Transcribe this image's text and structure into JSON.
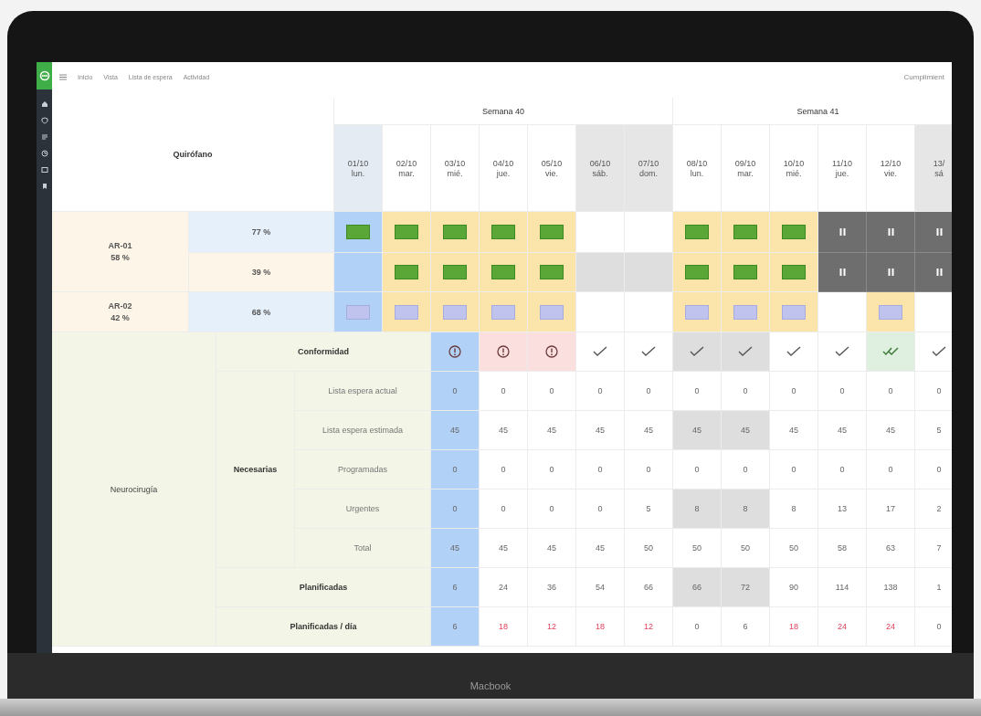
{
  "breadcrumb": [
    "Inicio",
    "Vista",
    "Lista de espera",
    "Actividad"
  ],
  "header_right": "Cumplimient",
  "table": {
    "corner": "Quirófano",
    "weeks": [
      {
        "label": "Semana 40",
        "days": [
          {
            "date": "01/10",
            "weekday": "lun.",
            "kind": "today"
          },
          {
            "date": "02/10",
            "weekday": "mar.",
            "kind": "workday"
          },
          {
            "date": "03/10",
            "weekday": "mié.",
            "kind": "workday"
          },
          {
            "date": "04/10",
            "weekday": "jue.",
            "kind": "workday"
          },
          {
            "date": "05/10",
            "weekday": "vie.",
            "kind": "workday"
          },
          {
            "date": "06/10",
            "weekday": "sáb.",
            "kind": "weekend"
          },
          {
            "date": "07/10",
            "weekday": "dom.",
            "kind": "weekend"
          }
        ]
      },
      {
        "label": "Semana 41",
        "days": [
          {
            "date": "08/10",
            "weekday": "lun.",
            "kind": "workday"
          },
          {
            "date": "09/10",
            "weekday": "mar.",
            "kind": "workday"
          },
          {
            "date": "10/10",
            "weekday": "mié.",
            "kind": "workday"
          },
          {
            "date": "11/10",
            "weekday": "jue.",
            "kind": "workday"
          },
          {
            "date": "12/10",
            "weekday": "vie.",
            "kind": "workday"
          },
          {
            "date": "13/",
            "weekday": "sá",
            "kind": "weekend"
          }
        ]
      }
    ],
    "rooms": [
      {
        "name": "AR-01",
        "percent": "58 %",
        "lines": [
          {
            "percent": "77 %",
            "highlighted": true,
            "cells": [
              {
                "kind": "session",
                "scheduled": false,
                "blocked": false
              },
              {
                "kind": "session",
                "scheduled": true,
                "blocked": false
              },
              {
                "kind": "session",
                "scheduled": true,
                "blocked": false
              },
              {
                "kind": "session",
                "scheduled": true,
                "blocked": false
              },
              {
                "kind": "session",
                "scheduled": true,
                "blocked": false
              },
              {
                "kind": "empty",
                "scheduled": false,
                "blocked": false
              },
              {
                "kind": "empty",
                "scheduled": false,
                "blocked": false
              },
              {
                "kind": "session",
                "scheduled": true,
                "blocked": false
              },
              {
                "kind": "session",
                "scheduled": true,
                "blocked": false
              },
              {
                "kind": "session",
                "scheduled": true,
                "blocked": false
              },
              {
                "kind": "closed"
              },
              {
                "kind": "closed"
              },
              {
                "kind": "closed"
              }
            ]
          },
          {
            "percent": "39 %",
            "highlighted": false,
            "cells": [
              {
                "kind": "empty",
                "scheduled": false,
                "blocked": false
              },
              {
                "kind": "session",
                "scheduled": true,
                "blocked": false
              },
              {
                "kind": "session",
                "scheduled": true,
                "blocked": false
              },
              {
                "kind": "session",
                "scheduled": true,
                "blocked": false
              },
              {
                "kind": "session",
                "scheduled": true,
                "blocked": false
              },
              {
                "kind": "empty",
                "scheduled": false,
                "blocked": true
              },
              {
                "kind": "empty",
                "scheduled": false,
                "blocked": true
              },
              {
                "kind": "session",
                "scheduled": true,
                "blocked": false
              },
              {
                "kind": "session",
                "scheduled": true,
                "blocked": false
              },
              {
                "kind": "session",
                "scheduled": true,
                "blocked": false
              },
              {
                "kind": "closed"
              },
              {
                "kind": "closed"
              },
              {
                "kind": "closed"
              }
            ]
          }
        ]
      },
      {
        "name": "AR-02",
        "percent": "42 %",
        "lines": [
          {
            "percent": "68 %",
            "highlighted": true,
            "cells": [
              {
                "kind": "reserved",
                "scheduled": false,
                "blocked": false
              },
              {
                "kind": "reserved",
                "scheduled": true,
                "blocked": false
              },
              {
                "kind": "reserved",
                "scheduled": true,
                "blocked": false
              },
              {
                "kind": "reserved",
                "scheduled": true,
                "blocked": false
              },
              {
                "kind": "reserved",
                "scheduled": true,
                "blocked": false
              },
              {
                "kind": "empty",
                "scheduled": false,
                "blocked": false
              },
              {
                "kind": "empty",
                "scheduled": false,
                "blocked": false
              },
              {
                "kind": "reserved",
                "scheduled": true,
                "blocked": false
              },
              {
                "kind": "reserved",
                "scheduled": true,
                "blocked": false
              },
              {
                "kind": "reserved",
                "scheduled": true,
                "blocked": false
              },
              {
                "kind": "empty",
                "scheduled": false,
                "blocked": false
              },
              {
                "kind": "reserved",
                "scheduled": true,
                "blocked": false
              },
              {
                "kind": "empty",
                "scheduled": false,
                "blocked": false
              }
            ]
          }
        ]
      }
    ],
    "service": "Neurocirugía",
    "conformity": {
      "label": "Conformidad",
      "cells": [
        {
          "kind": "warning",
          "current": true,
          "flagged": false,
          "dimmed": false,
          "highlighted": false
        },
        {
          "kind": "warning",
          "current": false,
          "flagged": true,
          "dimmed": false,
          "highlighted": false
        },
        {
          "kind": "warning",
          "current": false,
          "flagged": true,
          "dimmed": false,
          "highlighted": false
        },
        {
          "kind": "ok",
          "current": false,
          "flagged": false,
          "dimmed": false,
          "highlighted": false
        },
        {
          "kind": "ok",
          "current": false,
          "flagged": false,
          "dimmed": false,
          "highlighted": false
        },
        {
          "kind": "ok",
          "current": false,
          "flagged": false,
          "dimmed": true,
          "highlighted": false
        },
        {
          "kind": "ok",
          "current": false,
          "flagged": false,
          "dimmed": true,
          "highlighted": false
        },
        {
          "kind": "ok",
          "current": false,
          "flagged": false,
          "dimmed": false,
          "highlighted": false
        },
        {
          "kind": "ok",
          "current": false,
          "flagged": false,
          "dimmed": false,
          "highlighted": false
        },
        {
          "kind": "double",
          "current": false,
          "flagged": false,
          "dimmed": false,
          "highlighted": true
        },
        {
          "kind": "ok",
          "current": false,
          "flagged": false,
          "dimmed": false,
          "highlighted": false
        }
      ]
    },
    "needed": {
      "label": "Necesarias",
      "rows": [
        {
          "label": "Lista espera actual",
          "cells": [
            {
              "value": "0",
              "current": true,
              "dimmed": false
            },
            {
              "value": "0",
              "current": false,
              "dimmed": false
            },
            {
              "value": "0",
              "current": false,
              "dimmed": false
            },
            {
              "value": "0",
              "current": false,
              "dimmed": false
            },
            {
              "value": "0",
              "current": false,
              "dimmed": false
            },
            {
              "value": "0",
              "current": false,
              "dimmed": false
            },
            {
              "value": "0",
              "current": false,
              "dimmed": false
            },
            {
              "value": "0",
              "current": false,
              "dimmed": false
            },
            {
              "value": "0",
              "current": false,
              "dimmed": false
            },
            {
              "value": "0",
              "current": false,
              "dimmed": false
            },
            {
              "value": "0",
              "current": false,
              "dimmed": false
            }
          ]
        },
        {
          "label": "Lista espera estimada",
          "cells": [
            {
              "value": "45",
              "current": true,
              "dimmed": false
            },
            {
              "value": "45",
              "current": false,
              "dimmed": false
            },
            {
              "value": "45",
              "current": false,
              "dimmed": false
            },
            {
              "value": "45",
              "current": false,
              "dimmed": false
            },
            {
              "value": "45",
              "current": false,
              "dimmed": false
            },
            {
              "value": "45",
              "current": false,
              "dimmed": true
            },
            {
              "value": "45",
              "current": false,
              "dimmed": true
            },
            {
              "value": "45",
              "current": false,
              "dimmed": false
            },
            {
              "value": "45",
              "current": false,
              "dimmed": false
            },
            {
              "value": "45",
              "current": false,
              "dimmed": false
            },
            {
              "value": "5",
              "current": false,
              "dimmed": false
            }
          ]
        },
        {
          "label": "Programadas",
          "cells": [
            {
              "value": "0",
              "current": true,
              "dimmed": false
            },
            {
              "value": "0",
              "current": false,
              "dimmed": false
            },
            {
              "value": "0",
              "current": false,
              "dimmed": false
            },
            {
              "value": "0",
              "current": false,
              "dimmed": false
            },
            {
              "value": "0",
              "current": false,
              "dimmed": false
            },
            {
              "value": "0",
              "current": false,
              "dimmed": false
            },
            {
              "value": "0",
              "current": false,
              "dimmed": false
            },
            {
              "value": "0",
              "current": false,
              "dimmed": false
            },
            {
              "value": "0",
              "current": false,
              "dimmed": false
            },
            {
              "value": "0",
              "current": false,
              "dimmed": false
            },
            {
              "value": "0",
              "current": false,
              "dimmed": false
            }
          ]
        },
        {
          "label": "Urgentes",
          "cells": [
            {
              "value": "0",
              "current": true,
              "dimmed": false
            },
            {
              "value": "0",
              "current": false,
              "dimmed": false
            },
            {
              "value": "0",
              "current": false,
              "dimmed": false
            },
            {
              "value": "0",
              "current": false,
              "dimmed": false
            },
            {
              "value": "5",
              "current": false,
              "dimmed": false
            },
            {
              "value": "8",
              "current": false,
              "dimmed": true
            },
            {
              "value": "8",
              "current": false,
              "dimmed": true
            },
            {
              "value": "8",
              "current": false,
              "dimmed": false
            },
            {
              "value": "13",
              "current": false,
              "dimmed": false
            },
            {
              "value": "17",
              "current": false,
              "dimmed": false
            },
            {
              "value": "2",
              "current": false,
              "dimmed": false
            }
          ]
        },
        {
          "label": "Total",
          "cells": [
            {
              "value": "45",
              "current": true,
              "dimmed": false
            },
            {
              "value": "45",
              "current": false,
              "dimmed": false
            },
            {
              "value": "45",
              "current": false,
              "dimmed": false
            },
            {
              "value": "45",
              "current": false,
              "dimmed": false
            },
            {
              "value": "50",
              "current": false,
              "dimmed": false
            },
            {
              "value": "50",
              "current": false,
              "dimmed": false
            },
            {
              "value": "50",
              "current": false,
              "dimmed": false
            },
            {
              "value": "50",
              "current": false,
              "dimmed": false
            },
            {
              "value": "58",
              "current": false,
              "dimmed": false
            },
            {
              "value": "63",
              "current": false,
              "dimmed": false
            },
            {
              "value": "7",
              "current": false,
              "dimmed": false
            }
          ]
        }
      ]
    },
    "planned": {
      "label": "Planificadas",
      "cells": [
        {
          "value": "6",
          "current": true,
          "dimmed": false
        },
        {
          "value": "24",
          "current": false,
          "dimmed": false
        },
        {
          "value": "36",
          "current": false,
          "dimmed": false
        },
        {
          "value": "54",
          "current": false,
          "dimmed": false
        },
        {
          "value": "66",
          "current": false,
          "dimmed": false
        },
        {
          "value": "66",
          "current": false,
          "dimmed": true
        },
        {
          "value": "72",
          "current": false,
          "dimmed": true
        },
        {
          "value": "90",
          "current": false,
          "dimmed": false
        },
        {
          "value": "114",
          "current": false,
          "dimmed": false
        },
        {
          "value": "138",
          "current": false,
          "dimmed": false
        },
        {
          "value": "1",
          "current": false,
          "dimmed": false
        }
      ]
    },
    "planned_per_day": {
      "label": "Planificadas / día",
      "cells": [
        {
          "value": "6",
          "current": true,
          "alert": false
        },
        {
          "value": "18",
          "current": false,
          "alert": true
        },
        {
          "value": "12",
          "current": false,
          "alert": true
        },
        {
          "value": "18",
          "current": false,
          "alert": true
        },
        {
          "value": "12",
          "current": false,
          "alert": true
        },
        {
          "value": "0",
          "current": false,
          "alert": false
        },
        {
          "value": "6",
          "current": false,
          "alert": false
        },
        {
          "value": "18",
          "current": false,
          "alert": true
        },
        {
          "value": "24",
          "current": false,
          "alert": true
        },
        {
          "value": "24",
          "current": false,
          "alert": true
        },
        {
          "value": "0",
          "current": false,
          "alert": false
        }
      ]
    }
  },
  "device_label": "Macbook"
}
